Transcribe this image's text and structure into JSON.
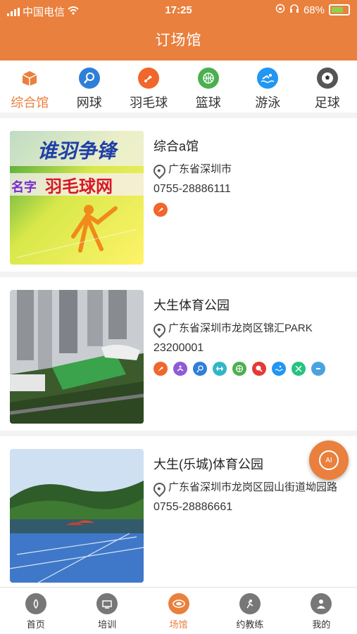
{
  "status": {
    "carrier": "中国电信",
    "time": "17:25",
    "battery": "68%"
  },
  "header": {
    "title": "订场馆"
  },
  "tabs": [
    {
      "label": "综合馆",
      "icon": "building-box-icon",
      "color": "#e9803d"
    },
    {
      "label": "网球",
      "icon": "tennis-icon",
      "color": "#2f7fd8"
    },
    {
      "label": "羽毛球",
      "icon": "badminton-icon",
      "color": "#f0662b"
    },
    {
      "label": "篮球",
      "icon": "basketball-icon",
      "color": "#4caf50"
    },
    {
      "label": "游泳",
      "icon": "swimming-icon",
      "color": "#2196f3"
    },
    {
      "label": "足球",
      "icon": "soccer-icon",
      "color": "#555555"
    }
  ],
  "venues": [
    {
      "name": "综合a馆",
      "address": "广东省深圳市",
      "phone": "0755-28886111",
      "image_text_1": "谁羽争锋",
      "image_text_2": "名字",
      "image_text_3": "羽毛球网"
    },
    {
      "name": "大生体育公园",
      "address": "广东省深圳市龙岗区锦汇PARK",
      "phone": "23200001"
    },
    {
      "name": "大生(乐城)体育公园",
      "address": "广东省深圳市龙岗区园山街道坳园路",
      "phone": "0755-28886661"
    }
  ],
  "ai_button": {
    "label": "AI"
  },
  "bottom_nav": [
    {
      "label": "首页",
      "icon": "home-icon"
    },
    {
      "label": "培训",
      "icon": "training-icon"
    },
    {
      "label": "场馆",
      "icon": "venue-icon"
    },
    {
      "label": "约教练",
      "icon": "coach-icon"
    },
    {
      "label": "我的",
      "icon": "profile-icon"
    }
  ],
  "colors": {
    "accent": "#e9803d"
  }
}
